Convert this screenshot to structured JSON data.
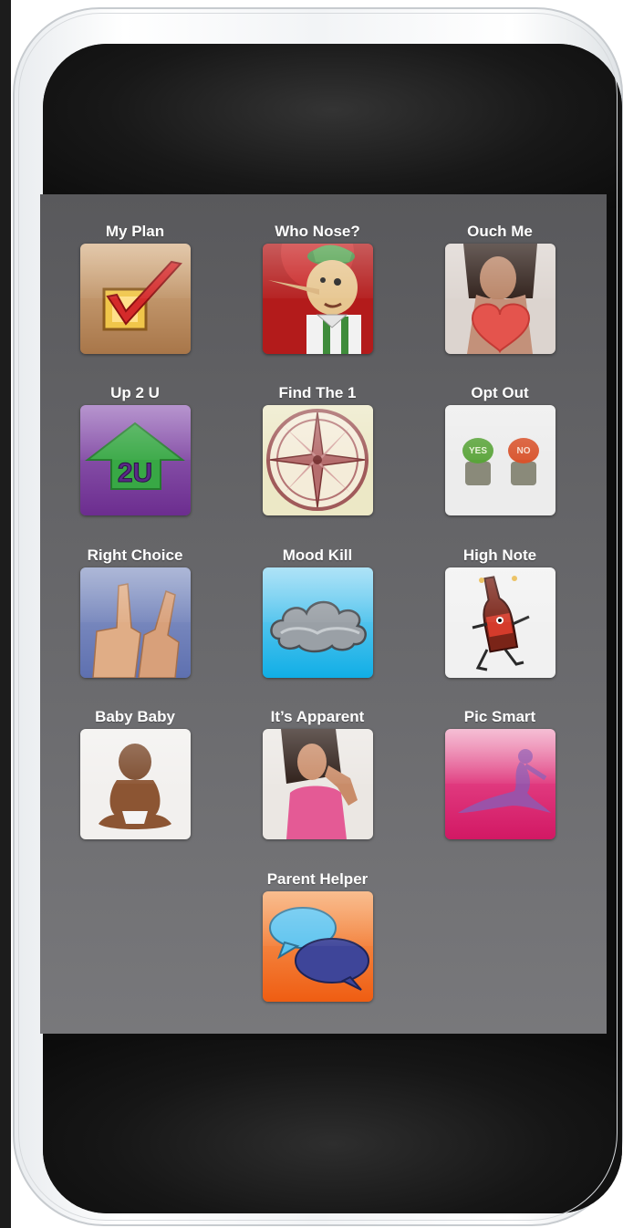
{
  "apps": [
    {
      "label": "My Plan",
      "icon": "checkbox-icon",
      "color": "#b8875a"
    },
    {
      "label": "Who Nose?",
      "icon": "pinocchio-icon",
      "color": "#b91d1d"
    },
    {
      "label": "Ouch Me",
      "icon": "heart-icon",
      "color": "#e5544e"
    },
    {
      "label": "Up 2 U",
      "icon": "arrow-up-icon",
      "color": "#7a3d9e"
    },
    {
      "label": "Find The 1",
      "icon": "compass-icon",
      "color": "#a86a6a"
    },
    {
      "label": "Opt Out",
      "icon": "yes-no-buttons-icon",
      "color": "#d8d8d8"
    },
    {
      "label": "Right Choice",
      "icon": "thumbs-up-icon",
      "color": "#6f7fb6"
    },
    {
      "label": "Mood Kill",
      "icon": "cloud-icon",
      "color": "#27b7ea"
    },
    {
      "label": "High Note",
      "icon": "bottle-icon",
      "color": "#8c1e1e"
    },
    {
      "label": "Baby Baby",
      "icon": "baby-icon",
      "color": "#e9e6e3"
    },
    {
      "label": "It’s Apparent",
      "icon": "woman-icon",
      "color": "#e6539a"
    },
    {
      "label": "Pic Smart",
      "icon": "silhouette-icon",
      "color": "#d91b6b"
    },
    {
      "label": "Parent Helper",
      "icon": "speech-bubbles-icon",
      "color": "#f26c23"
    }
  ]
}
